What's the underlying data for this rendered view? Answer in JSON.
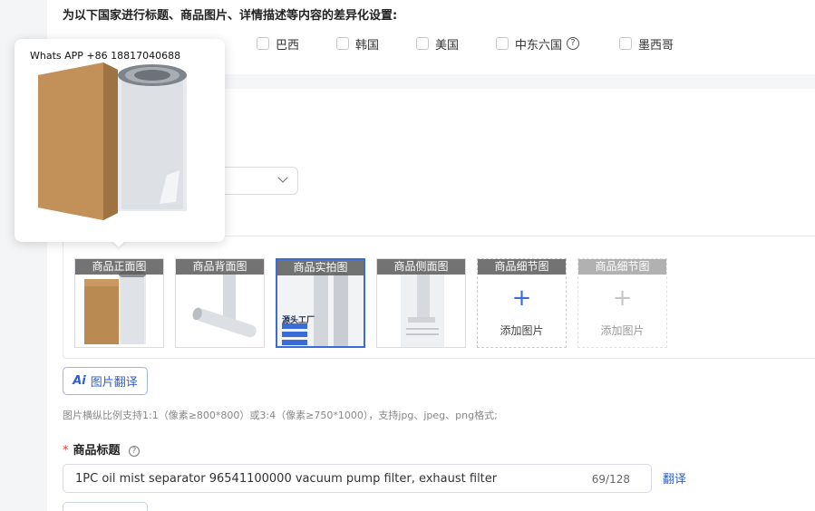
{
  "section": {
    "title": "为以下国家进行标题、商品图片、详情描述等内容的差异化设置:",
    "countries": [
      {
        "label": "巴西"
      },
      {
        "label": "韩国"
      },
      {
        "label": "美国"
      },
      {
        "label": "中东六国"
      },
      {
        "label": "墨西哥"
      }
    ]
  },
  "popup": {
    "watermark": "Whats APP +86 18817040688"
  },
  "images": {
    "slots": [
      {
        "caption": "商品正面图"
      },
      {
        "caption": "商品背面图"
      },
      {
        "caption": "商品实拍图",
        "overlay_text": "源头工厂"
      },
      {
        "caption": "商品侧面图"
      },
      {
        "caption": "商品细节图",
        "add_label": "添加图片"
      },
      {
        "caption": "商品细节图",
        "add_label": "添加图片"
      }
    ],
    "translate_button": {
      "ai": "Ai",
      "label": "图片翻译"
    },
    "hint": "图片横纵比例支持1:1（像素≥800*800）或3:4（像素≥750*1000），支持jpg、jpeg、png格式;"
  },
  "product_title": {
    "required_mark": "*",
    "label": "商品标题",
    "value": "1PC oil mist separator 96541100000 vacuum pump filter, exhaust filter",
    "counter": "69/128",
    "translate_link": "翻译"
  },
  "icons": {
    "help": "question-circle-icon",
    "add": "plus-icon",
    "dropdown": "chevron-down-icon"
  },
  "colors": {
    "accent": "#2f5fd0",
    "selected_border": "#3a6bd6",
    "required": "#e53935"
  }
}
